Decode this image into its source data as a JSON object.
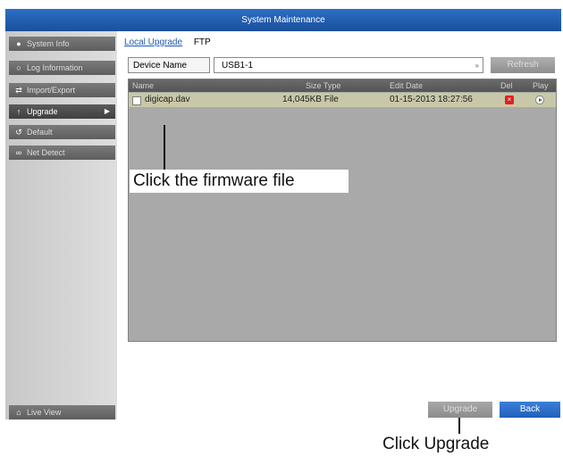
{
  "window": {
    "title": "System Maintenance"
  },
  "sidebar": {
    "items": [
      {
        "label": "System Info",
        "icon": "info-icon"
      },
      {
        "label": "Log Information",
        "icon": "search-icon"
      },
      {
        "label": "Import/Export",
        "icon": "arrows-icon"
      },
      {
        "label": "Upgrade",
        "icon": "upgrade-icon",
        "active": true
      },
      {
        "label": "Default",
        "icon": "default-icon"
      },
      {
        "label": "Net Detect",
        "icon": "network-icon"
      }
    ],
    "live_view": "Live View"
  },
  "tabs": [
    {
      "label": "Local Upgrade",
      "active": true
    },
    {
      "label": "FTP"
    }
  ],
  "device": {
    "label": "Device Name",
    "value": "USB1-1",
    "refresh_label": "Refresh"
  },
  "table": {
    "headers": {
      "name": "Name",
      "size_type": "Size Type",
      "edit_date": "Edit Date",
      "del": "Del",
      "play": "Play"
    },
    "rows": [
      {
        "name": "digicap.dav",
        "size_type": "14,045KB File",
        "edit_date": "01-15-2013 18:27:56"
      }
    ]
  },
  "buttons": {
    "upgrade": "Upgrade",
    "back": "Back"
  },
  "annotations": {
    "click_file": "Click the firmware file",
    "click_upgrade": "Click Upgrade"
  },
  "colors": {
    "titlebar": "#1b4f9a",
    "back_button": "#2060bb",
    "delete_icon": "#e02020",
    "tab_active": "#1d57b5"
  }
}
